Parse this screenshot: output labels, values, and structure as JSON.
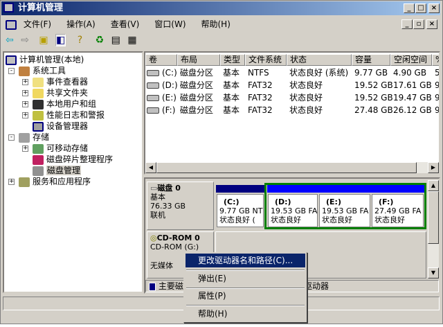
{
  "window": {
    "title": "计算机管理"
  },
  "menu": [
    "文件(F)",
    "操作(A)",
    "查看(V)",
    "窗口(W)",
    "帮助(H)"
  ],
  "toolbar": [
    "back-icon",
    "forward-icon",
    "up-folder-icon",
    "show-hide-tree-icon",
    "help-icon",
    "refresh-icon",
    "properties-icon",
    "export-icon"
  ],
  "tree": {
    "root": "计算机管理(本地)",
    "items": [
      {
        "label": "系统工具",
        "level": 1,
        "expander": "-"
      },
      {
        "label": "事件查看器",
        "level": 2,
        "expander": "+"
      },
      {
        "label": "共享文件夹",
        "level": 2,
        "expander": "+"
      },
      {
        "label": "本地用户和组",
        "level": 2,
        "expander": "+"
      },
      {
        "label": "性能日志和警报",
        "level": 2,
        "expander": "+"
      },
      {
        "label": "设备管理器",
        "level": 2,
        "expander": ""
      },
      {
        "label": "存储",
        "level": 1,
        "expander": "-"
      },
      {
        "label": "可移动存储",
        "level": 2,
        "expander": "+"
      },
      {
        "label": "磁盘碎片整理程序",
        "level": 2,
        "expander": ""
      },
      {
        "label": "磁盘管理",
        "level": 2,
        "expander": "",
        "selected": true
      },
      {
        "label": "服务和应用程序",
        "level": 1,
        "expander": "+"
      }
    ]
  },
  "volumes": {
    "columns": [
      "卷",
      "布局",
      "类型",
      "文件系统",
      "状态",
      "容量",
      "空闲空间",
      "%"
    ],
    "rows": [
      [
        "(C:)",
        "磁盘分区",
        "基本",
        "NTFS",
        "状态良好 (系统)",
        "9.77 GB",
        "4.90 GB",
        "5"
      ],
      [
        "(D:)",
        "磁盘分区",
        "基本",
        "FAT32",
        "状态良好",
        "19.52 GB",
        "17.61 GB",
        "9"
      ],
      [
        "(E:)",
        "磁盘分区",
        "基本",
        "FAT32",
        "状态良好",
        "19.52 GB",
        "19.47 GB",
        "9"
      ],
      [
        "(F:)",
        "磁盘分区",
        "基本",
        "FAT32",
        "状态良好",
        "27.48 GB",
        "26.12 GB",
        "9"
      ]
    ]
  },
  "disk0": {
    "name": "磁盘 0",
    "type": "基本",
    "size": "76.33 GB",
    "status": "联机",
    "partitions": [
      {
        "letter": "(C:)",
        "info": "9.77 GB NTI",
        "status": "状态良好 (",
        "color": "#000080"
      },
      {
        "letter": "(D:)",
        "info": "19.53 GB FA",
        "status": "状态良好",
        "color": "#0000ff"
      },
      {
        "letter": "(E:)",
        "info": "19.53 GB FA",
        "status": "状态良好",
        "color": "#0000ff"
      },
      {
        "letter": "(F:)",
        "info": "27.49 GB FA",
        "status": "状态良好",
        "color": "#0000ff"
      }
    ]
  },
  "cdrom": {
    "name": "CD-ROM 0",
    "drive": "CD-ROM (G:)",
    "status": "无媒体"
  },
  "legend": {
    "primary": "主要磁",
    "logical": "驱动器"
  },
  "context_menu": [
    "更改驱动器名和路径(C)...",
    "弹出(E)",
    "属性(P)",
    "帮助(H)"
  ],
  "colors": {
    "extended_border": "#008000",
    "selection": "#0a246a"
  }
}
